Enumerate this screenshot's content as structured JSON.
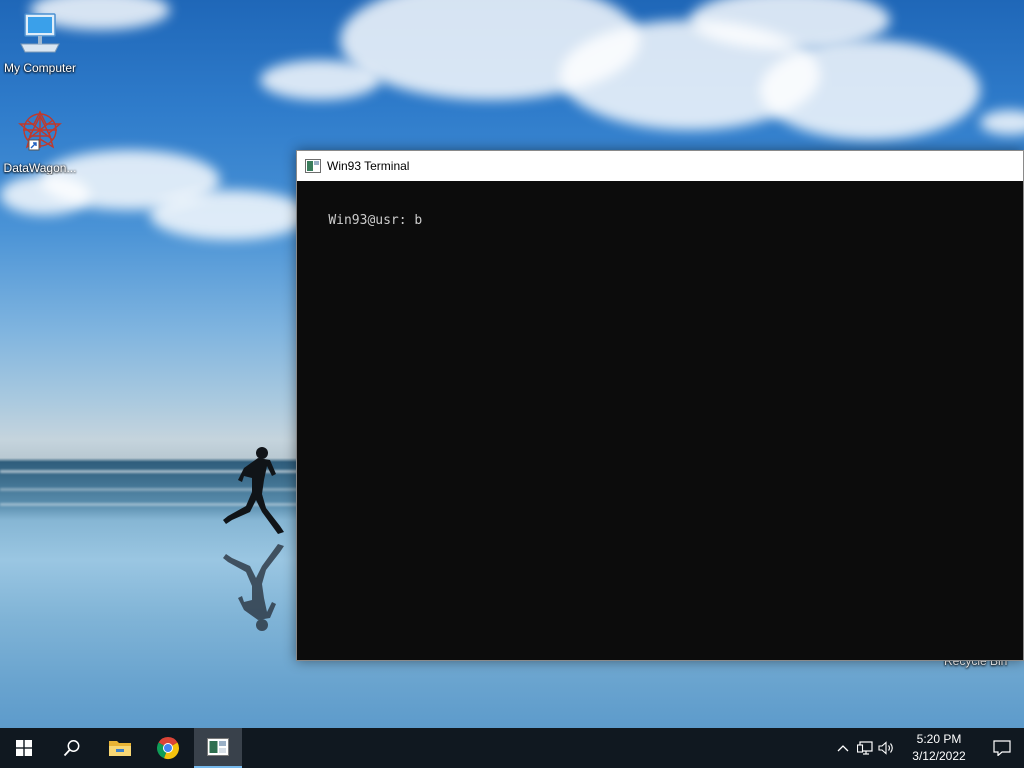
{
  "desktop": {
    "icons": [
      {
        "label": "My Computer",
        "icon": "computer-icon"
      },
      {
        "label": "DataWagon...",
        "icon": "datawagon-icon"
      }
    ],
    "recycle_bin_label": "Recycle Bin"
  },
  "terminal": {
    "title": "Win93 Terminal",
    "prompt_line": "Win93@usr: b"
  },
  "taskbar": {
    "pinned": [
      {
        "name": "start-icon"
      },
      {
        "name": "search-icon"
      },
      {
        "name": "file-explorer-icon"
      },
      {
        "name": "chrome-icon"
      },
      {
        "name": "terminal-icon",
        "active": true
      }
    ],
    "tray_icons": [
      "chevron-up-icon",
      "network-icon",
      "volume-icon"
    ],
    "time": "5:20 PM",
    "date": "3/12/2022"
  },
  "colors": {
    "taskbar": "#101820",
    "terminal_bg": "#0c0c0c",
    "terminal_text": "#cccccc",
    "active_underline": "#76b9ed"
  }
}
